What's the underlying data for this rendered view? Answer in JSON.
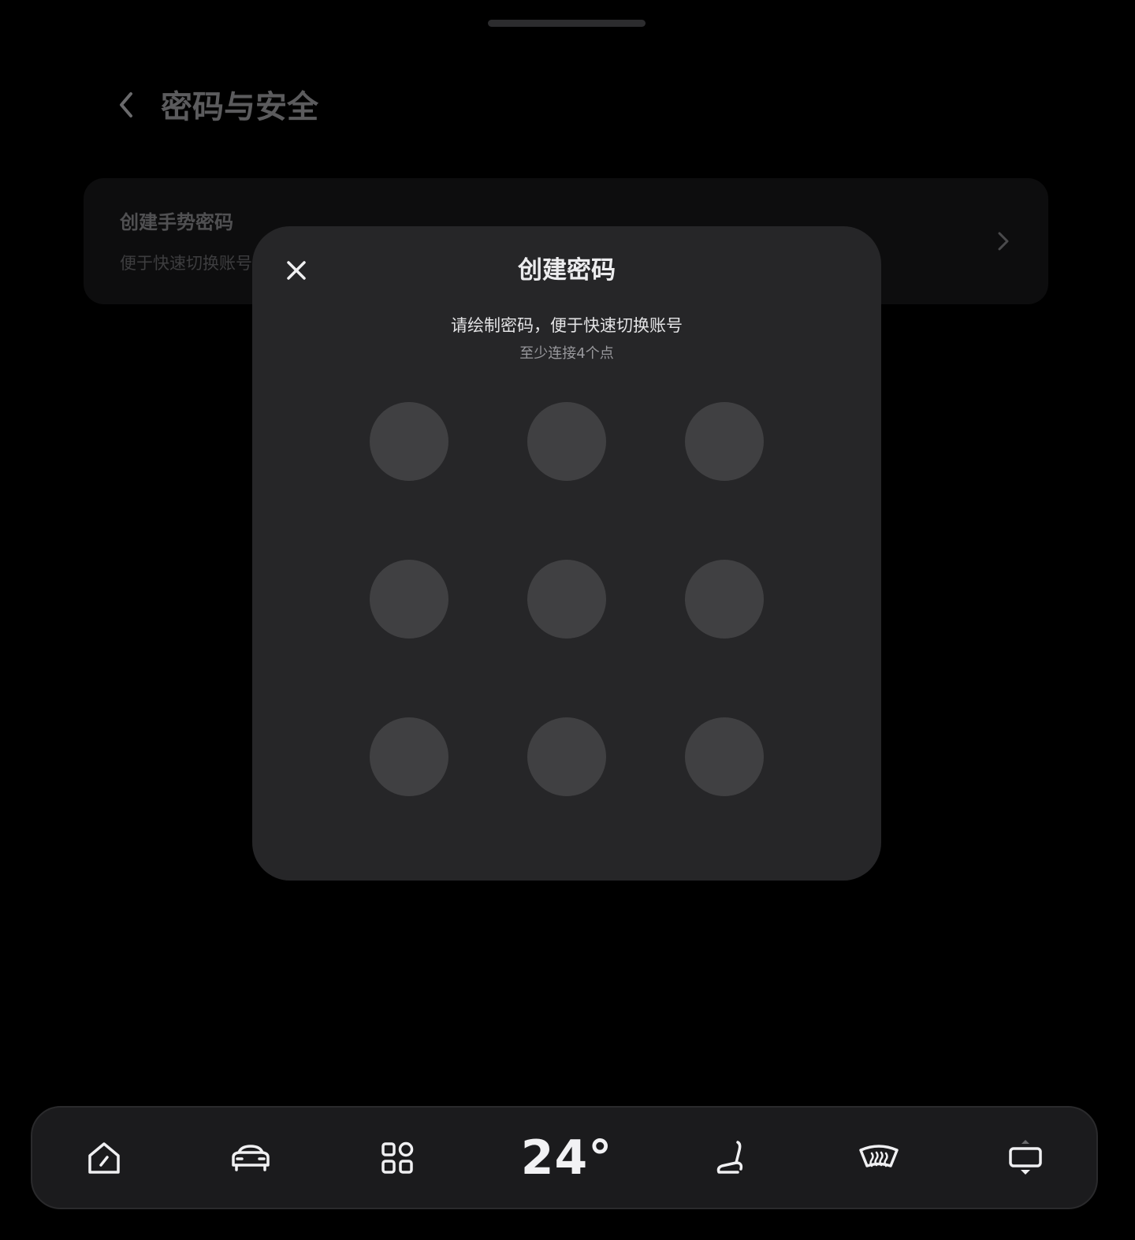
{
  "page": {
    "title": "密码与安全",
    "back_icon": "chevron-left-icon"
  },
  "setting_item": {
    "title": "创建手势密码",
    "subtitle": "便于快速切换账号",
    "chevron_icon": "chevron-right-icon"
  },
  "modal": {
    "title": "创建密码",
    "description": "请绘制密码，便于快速切换账号",
    "hint": "至少连接4个点",
    "close_icon": "close-icon",
    "pattern_dots": 9
  },
  "dock": {
    "items": [
      {
        "name": "home",
        "icon": "home-icon"
      },
      {
        "name": "car",
        "icon": "car-icon"
      },
      {
        "name": "apps",
        "icon": "apps-grid-icon"
      },
      {
        "name": "seat",
        "icon": "seat-icon"
      },
      {
        "name": "defrost",
        "icon": "windshield-defrost-icon"
      },
      {
        "name": "screen",
        "icon": "screen-icon"
      }
    ],
    "temperature": "24°"
  },
  "colors": {
    "background": "#000000",
    "modal": "#262628",
    "dot": "#404042",
    "dock": "#1b1b1d"
  }
}
